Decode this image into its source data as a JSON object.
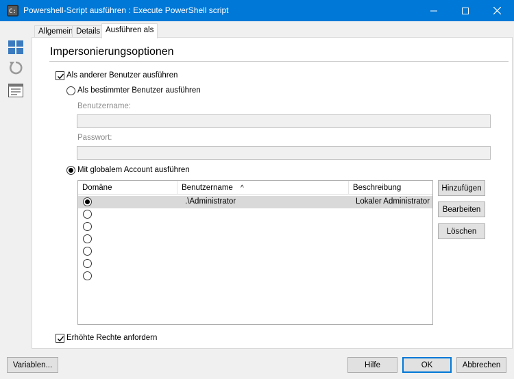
{
  "window": {
    "title": "Powershell-Script ausführen : Execute PowerShell script",
    "minimize_icon": "minimize-icon",
    "maximize_icon": "maximize-icon",
    "close_icon": "close-icon"
  },
  "sidebar": {
    "icons": [
      "grid-view-icon",
      "refresh-icon",
      "properties-icon"
    ]
  },
  "tabs": [
    {
      "label": "Allgemein",
      "active": false
    },
    {
      "label": "Details",
      "active": false
    },
    {
      "label": "Ausführen als",
      "active": true
    }
  ],
  "section": {
    "title": "Impersonierungsoptionen"
  },
  "options": {
    "run_as_other_user": {
      "label": "Als anderer Benutzer ausführen",
      "checked": true
    },
    "specific_user": {
      "label": "Als bestimmter Benutzer ausführen",
      "selected": false
    },
    "username_label": "Benutzername:",
    "username_value": "",
    "password_label": "Passwort:",
    "password_value": "",
    "global_account": {
      "label": "Mit globalem Account ausführen",
      "selected": true
    },
    "elevated": {
      "label": "Erhöhte Rechte anfordern",
      "checked": true
    }
  },
  "accounts_table": {
    "columns": [
      "Domäne",
      "Benutzername",
      "Beschreibung"
    ],
    "sort_indicator": "^",
    "rows": [
      {
        "domain": "",
        "username": ".\\Administrator",
        "description": "Lokaler Administrator",
        "selected": true
      },
      {
        "domain": "",
        "username": "",
        "description": "",
        "selected": false
      },
      {
        "domain": "",
        "username": "",
        "description": "",
        "selected": false
      },
      {
        "domain": "",
        "username": "",
        "description": "",
        "selected": false
      },
      {
        "domain": "",
        "username": "",
        "description": "",
        "selected": false
      },
      {
        "domain": "",
        "username": "",
        "description": "",
        "selected": false
      },
      {
        "domain": "",
        "username": "",
        "description": "",
        "selected": false
      }
    ]
  },
  "table_buttons": {
    "add": "Hinzufügen",
    "edit": "Bearbeiten",
    "delete": "Löschen"
  },
  "footer": {
    "variables": "Variablen...",
    "help": "Hilfe",
    "ok": "OK",
    "cancel": "Abbrechen"
  },
  "colors": {
    "titlebar": "#0078d7",
    "accent": "#0078d7",
    "selected_row": "#d9d9d9"
  }
}
